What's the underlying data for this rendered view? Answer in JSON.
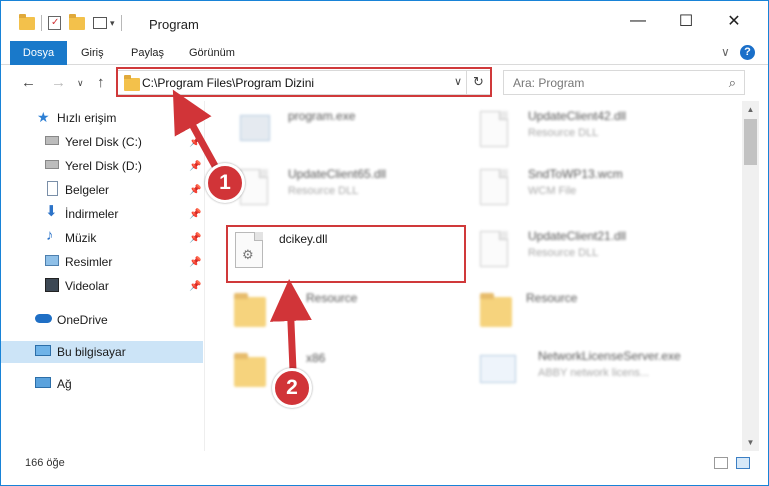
{
  "window": {
    "title": "Program",
    "controls": {
      "minimize": "—",
      "maximize": "☐",
      "close": "✕"
    }
  },
  "ribbon": {
    "tabs": [
      "Dosya",
      "Giriş",
      "Paylaş",
      "Görünüm"
    ],
    "expand_glyph": "∨",
    "help_glyph": "?"
  },
  "nav": {
    "back": "←",
    "forward": "→",
    "dropdown": "∨",
    "up": "↑",
    "address": "C:\\Program Files\\Program Dizini",
    "address_dropdown": "∨",
    "refresh": "↻",
    "search_placeholder": "Ara: Program",
    "search_icon": "search-icon"
  },
  "sidebar": {
    "items": [
      {
        "label": "Hızlı erişim",
        "icon": "star-icon"
      },
      {
        "label": "Yerel Disk (C:)",
        "icon": "drive-icon",
        "pinned": true
      },
      {
        "label": "Yerel Disk (D:)",
        "icon": "drive-icon",
        "pinned": true
      },
      {
        "label": "Belgeler",
        "icon": "documents-icon",
        "pinned": true
      },
      {
        "label": "İndirmeler",
        "icon": "download-icon",
        "pinned": true
      },
      {
        "label": "Müzik",
        "icon": "music-icon",
        "pinned": true
      },
      {
        "label": "Resimler",
        "icon": "pictures-icon",
        "pinned": true
      },
      {
        "label": "Videolar",
        "icon": "videos-icon",
        "pinned": true
      },
      {
        "label": "OneDrive",
        "icon": "cloud-icon"
      },
      {
        "label": "Bu bilgisayar",
        "icon": "computer-icon",
        "selected": true
      },
      {
        "label": "Ağ",
        "icon": "network-icon"
      }
    ],
    "pin_glyph": "📌"
  },
  "files": {
    "left": [
      {
        "name": "program.exe",
        "sub": ""
      },
      {
        "name": "UpdateClient65.dll",
        "sub": "Resource DLL"
      },
      {
        "name": "dcikey.dll",
        "sub": ""
      },
      {
        "name": "Resource",
        "sub": ""
      },
      {
        "name": "x86",
        "sub": ""
      }
    ],
    "right": [
      {
        "name": "UpdateClient42.dll",
        "sub": "Resource DLL"
      },
      {
        "name": "SndToWP13.wcm",
        "sub": "WCM File"
      },
      {
        "name": "UpdateClient21.dll",
        "sub": "Resource DLL"
      },
      {
        "name": "Resource",
        "sub": ""
      },
      {
        "name": "NetworkLicenseServer.exe",
        "sub": "ABBY network licens..."
      }
    ]
  },
  "status": {
    "count": "166 öğe"
  },
  "annotations": {
    "step1": "1",
    "step2": "2",
    "color": "#d13438"
  },
  "scrollbar": {
    "up": "▲",
    "down": "▼"
  }
}
